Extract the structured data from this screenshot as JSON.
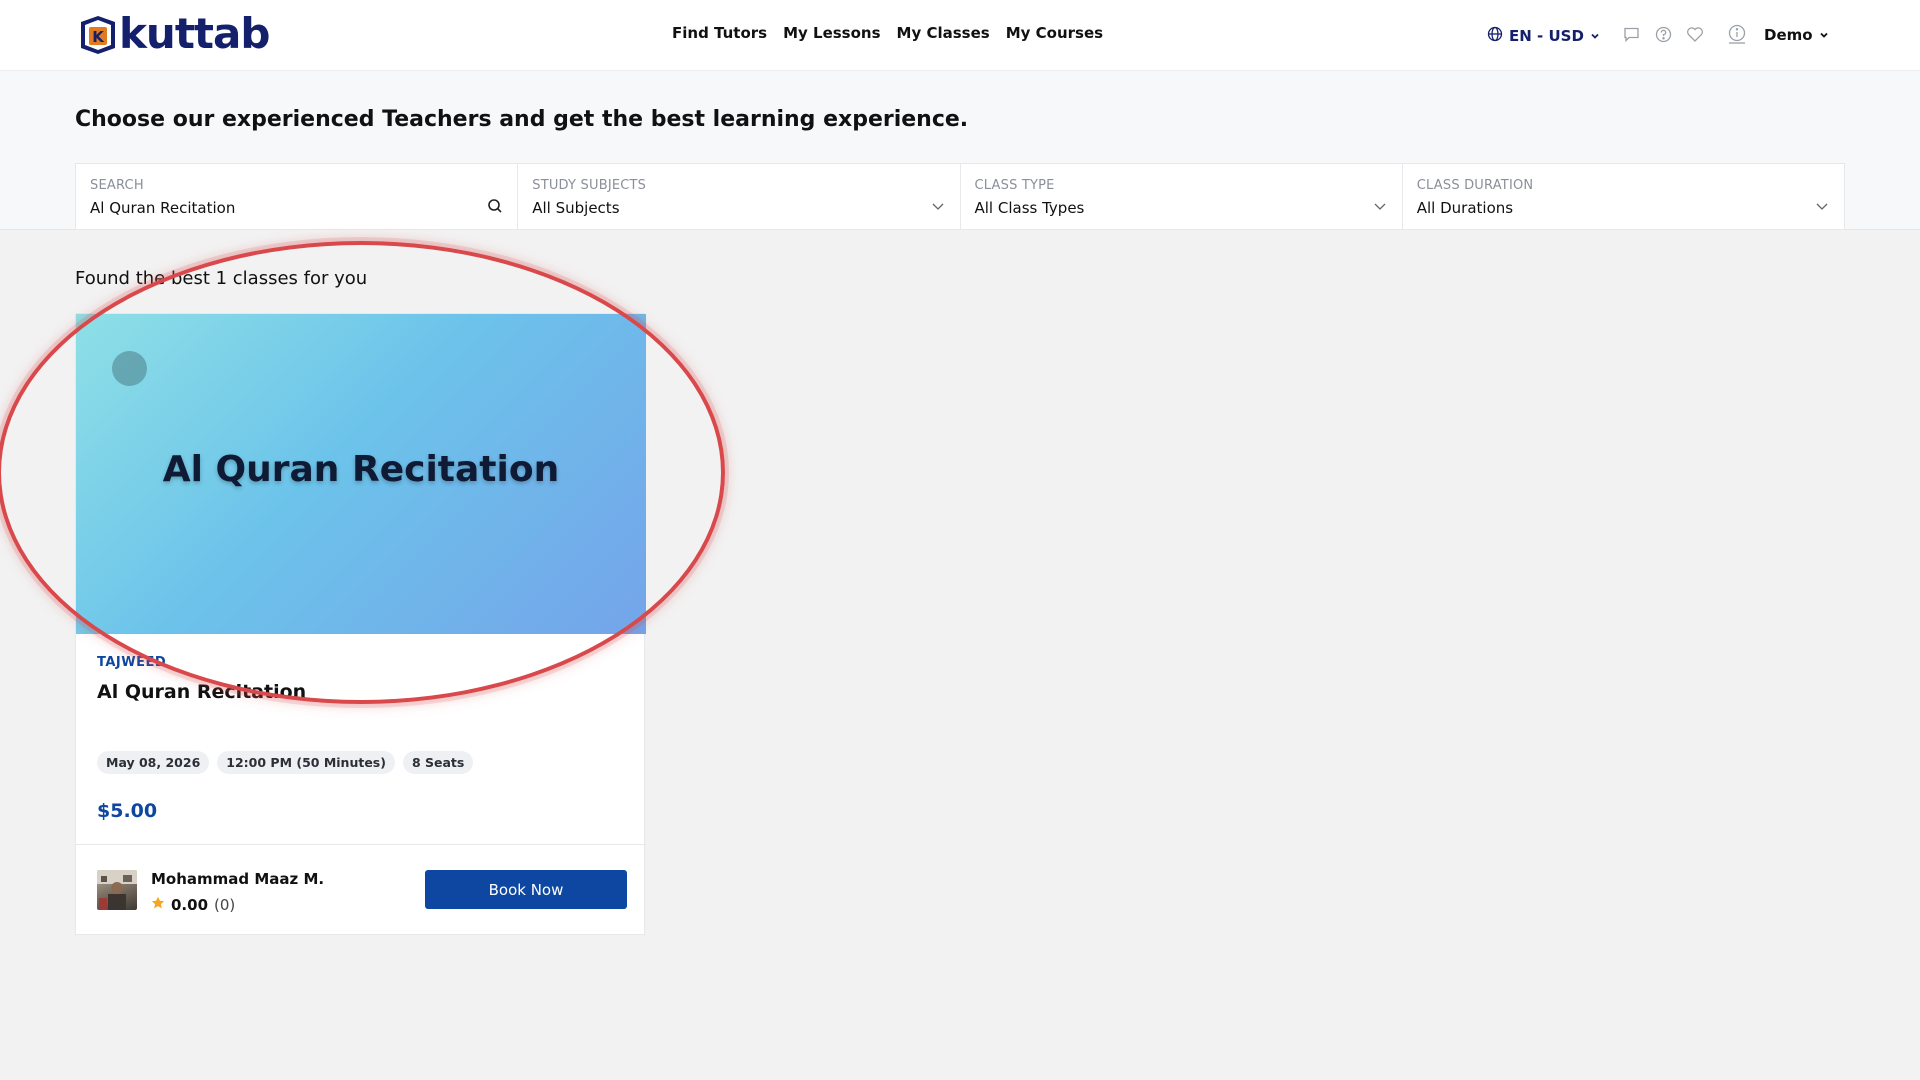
{
  "header": {
    "logo_text": "kuttab",
    "logo_letter": "K",
    "nav": [
      "Find Tutors",
      "My Lessons",
      "My Classes",
      "My Courses"
    ],
    "language": "EN - USD",
    "user": "Demo",
    "icons": [
      "globe-icon",
      "chat-icon",
      "help-icon",
      "heart-icon",
      "info-icon"
    ]
  },
  "hero": {
    "headline": "Choose our experienced Teachers and get the best learning experience."
  },
  "filters": {
    "search": {
      "label": "SEARCH",
      "value": "Al Quran Recitation"
    },
    "subjects": {
      "label": "STUDY SUBJECTS",
      "value": "All Subjects"
    },
    "class_type": {
      "label": "CLASS TYPE",
      "value": "All Class Types"
    },
    "duration": {
      "label": "CLASS DURATION",
      "value": "All Durations"
    }
  },
  "results": {
    "summary": "Found the best 1 classes for you",
    "cards": [
      {
        "thumbnail_title": "Al Quran Recitation",
        "category": "TAJWEED",
        "title": "Al Quran Recitation",
        "date": "May 08, 2026",
        "time": "12:00 PM (50 Minutes)",
        "seats": "8 Seats",
        "price": "$5.00",
        "tutor_name": "Mohammad Maaz M.",
        "rating": "0.00",
        "rating_count": "(0)",
        "book_label": "Book Now"
      }
    ]
  },
  "colors": {
    "brand_navy": "#14206b",
    "primary_blue": "#0d47a1",
    "annotation_red": "#d9484a",
    "star": "#f5a623"
  }
}
